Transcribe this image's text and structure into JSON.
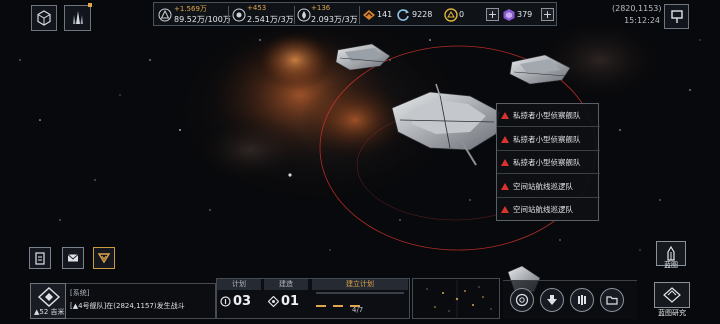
{
  "resources": {
    "r1": {
      "icon": "triangle-crystal-icon",
      "increment": "+1.569万",
      "value": "89.52万/100万"
    },
    "r2": {
      "icon": "orb-resource-icon",
      "increment": "+453",
      "value": "2.541万/3万"
    },
    "r3": {
      "icon": "droplet-resource-icon",
      "increment": "+136",
      "value": "2.093万/3万"
    },
    "r4": {
      "icon": "chevron-badge-icon",
      "value": "141"
    },
    "r5": {
      "icon": "refresh-token-icon",
      "value": "9228"
    },
    "r6": {
      "icon": "gold-coin-icon",
      "value": "0"
    },
    "r7": {
      "icon": "purple-gem-icon",
      "value": "379"
    },
    "plus": "+"
  },
  "status": {
    "coords": "(2820,1153)",
    "time": "15:12:24"
  },
  "context_menu": {
    "items": [
      {
        "label": "私掠者小型侦察舰队"
      },
      {
        "label": "私掠者小型侦察舰队"
      },
      {
        "label": "私掠者小型侦察舰队"
      },
      {
        "label": "空间站航线巡逻队"
      },
      {
        "label": "空间站航线巡逻队"
      }
    ]
  },
  "chat": {
    "channel": "[系统]",
    "message": "[▲4号舰队]在(2824,1157)发生战斗",
    "level": "▲52 吉米"
  },
  "plan_panel": {
    "tab_plan": "计划",
    "tab_build": "建造",
    "tab_build_plan": "建立计划",
    "plan_count": "03",
    "build_count": "01",
    "progress": "4/7"
  },
  "right_buttons": {
    "blueprint_label": "蓝图",
    "blueprint_research_label": "蓝图研究"
  },
  "colors": {
    "hostile": "#d8342c",
    "resource_increment": "#e0a64a",
    "tab_active": "#e0a64a"
  }
}
